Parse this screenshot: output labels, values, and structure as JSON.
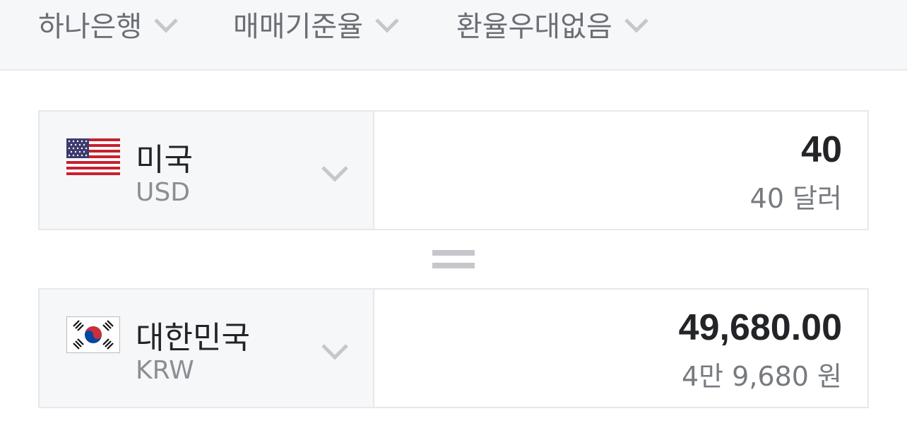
{
  "filters": [
    {
      "label": "하나은행",
      "icon": "chevron-down-icon"
    },
    {
      "label": "매매기준율",
      "icon": "chevron-down-icon"
    },
    {
      "label": "환율우대없음",
      "icon": "chevron-down-icon"
    }
  ],
  "from": {
    "country": "미국",
    "code": "USD",
    "flag_icon": "us-flag-icon",
    "amount": "40",
    "amount_words": "40 달러"
  },
  "to": {
    "country": "대한민국",
    "code": "KRW",
    "flag_icon": "kr-flag-icon",
    "amount": "49,680.00",
    "amount_words": "4만 9,680 원"
  },
  "colors": {
    "bar_bg": "#f6f7f9",
    "border": "#e6e8ec",
    "text_primary": "#222427",
    "text_secondary": "#8b8e94",
    "chevron": "#c5c7cb"
  }
}
